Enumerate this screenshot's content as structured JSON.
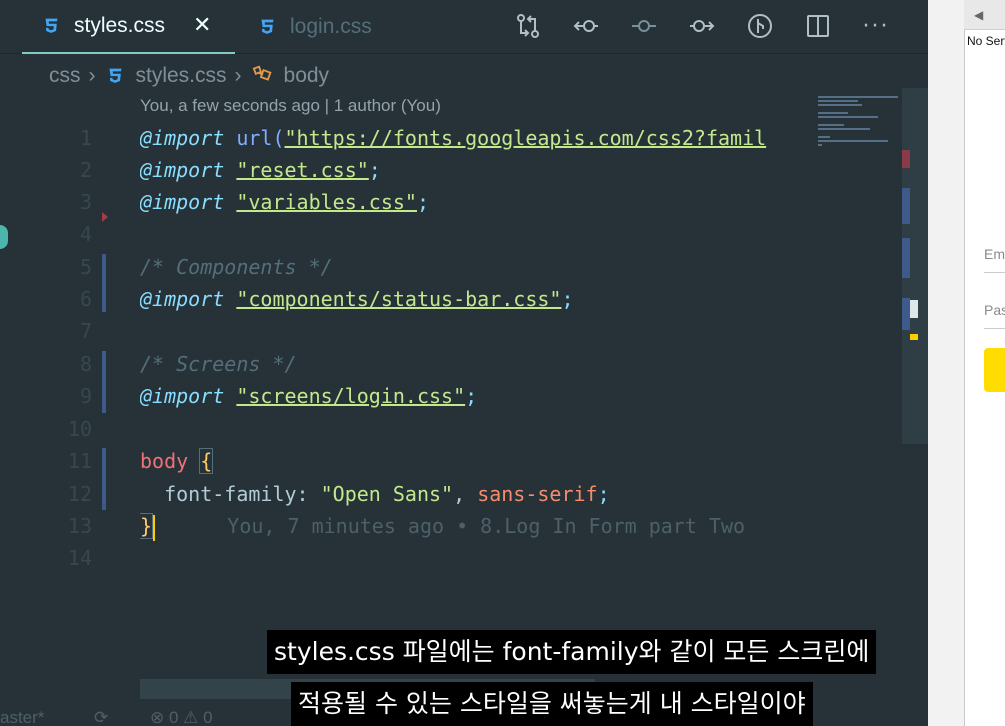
{
  "tabs": [
    {
      "label": "styles.css",
      "active": true,
      "icon": "css3-icon"
    },
    {
      "label": "login.css",
      "active": false,
      "icon": "css3-icon"
    }
  ],
  "toolbar": {
    "icons": [
      "git-compare-icon",
      "go-back-icon",
      "git-commit-icon",
      "go-forward-icon",
      "git-graph-icon",
      "split-editor-icon",
      "more-actions-icon"
    ],
    "more_label": "···"
  },
  "breadcrumb": {
    "folder": "css",
    "file": "styles.css",
    "symbol": "body"
  },
  "blame_header": "You, a few seconds ago | 1 author (You)",
  "editor": {
    "line_numbers": [
      "1",
      "2",
      "3",
      "4",
      "5",
      "6",
      "7",
      "8",
      "9",
      "10",
      "11",
      "12",
      "13",
      "14"
    ],
    "lines": {
      "l1_kw": "@import",
      "l1_fn": " url(",
      "l1_str": "\"https://fonts.googleapis.com/css2?famil",
      "l2_kw": "@import",
      "l2_str": "\"reset.css\"",
      "l3_kw": "@import",
      "l3_str": "\"variables.css\"",
      "l5_cmt": "/* Components */",
      "l6_kw": "@import",
      "l6_str": "\"components/status-bar.css\"",
      "l8_cmt": "/* Screens */",
      "l9_kw": "@import",
      "l9_str": "\"screens/login.css\"",
      "l11_sel": "body",
      "l11_brace": "{",
      "l12_prop": "  font-family",
      "l12_colon": ": ",
      "l12_str": "\"Open Sans\"",
      "l12_comma": ", ",
      "l12_val": "sans-serif",
      "l12_semi": ";",
      "semi": ";",
      "l13_brace": "}",
      "l13_blame": "      You, 7 minutes ago • 8.Log In Form part Two"
    }
  },
  "statusbar": {
    "branch": "aster*",
    "problems": "⊗ 0 ⚠ 0"
  },
  "browser": {
    "status_text": "No Serv",
    "email_placeholder": "Ema",
    "password_placeholder": "Pas"
  },
  "subtitles": [
    "styles.css 파일에는 font-family와 같이 모든 스크린에",
    "적용될 수 있는 스타일을 써놓는게 내 스타일이야"
  ],
  "colors": {
    "editor_bg": "#263238",
    "keyword": "#89ddff",
    "string": "#c3e88d",
    "selector": "#f07178",
    "value": "#f78c6c",
    "comment": "#546e7a",
    "css_icon": "#42a5f5",
    "cursor": "#ffcc00"
  }
}
